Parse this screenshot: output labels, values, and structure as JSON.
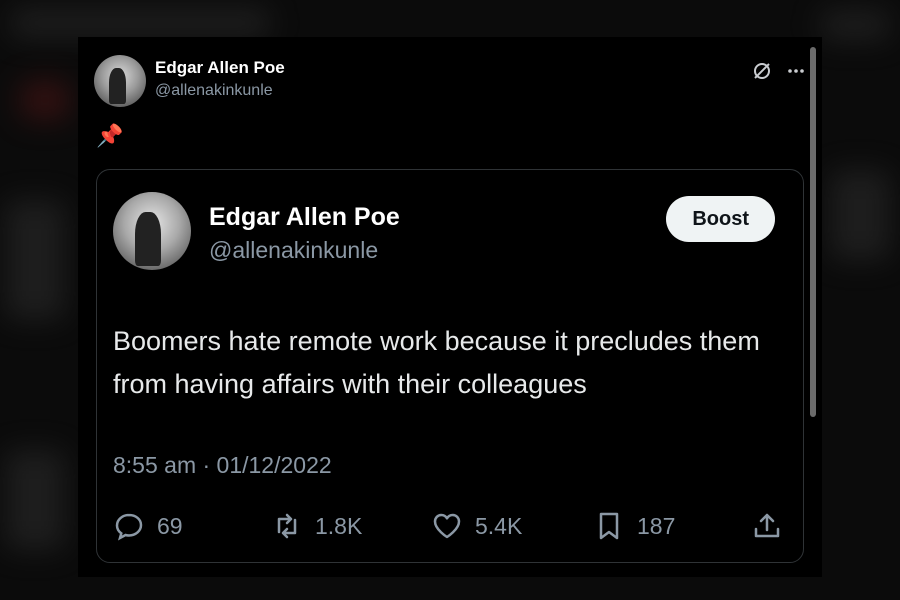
{
  "tweet": {
    "author_name": "Edgar Allen Poe",
    "author_handle": "@allenakinkunle",
    "pin_icon": "📌",
    "quoted": {
      "author_name": "Edgar Allen Poe",
      "author_handle": "@allenakinkunle",
      "follow_button": "Boost",
      "text": "Boomers hate remote work because it precludes them from having affairs with their colleagues",
      "timestamp": "8:55 am · 01/12/2022",
      "replies": "69",
      "reposts": "1.8K",
      "likes": "5.4K",
      "bookmarks": "187"
    }
  },
  "colors": {
    "background": "#000000",
    "muted_text": "#8b98a5",
    "primary_text": "#e7e9ea",
    "button_bg": "#eff3f4"
  },
  "icons": [
    "grok-icon",
    "more-icon",
    "pin-icon",
    "reply-icon",
    "repost-icon",
    "like-icon",
    "bookmark-icon",
    "share-icon"
  ]
}
